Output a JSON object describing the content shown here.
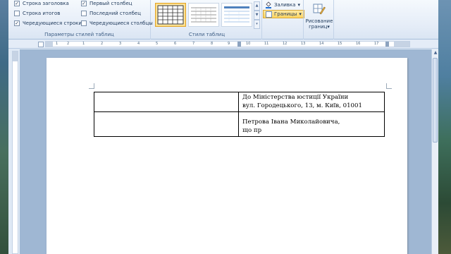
{
  "ribbon": {
    "options_group": {
      "caption": "Параметры стилей таблиц",
      "checkboxes": [
        {
          "label": "Строка заголовка",
          "checked": true
        },
        {
          "label": "Строка итогов",
          "checked": false
        },
        {
          "label": "Чередующиеся строки",
          "checked": true
        },
        {
          "label": "Первый столбец",
          "checked": true
        },
        {
          "label": "Последний столбец",
          "checked": false
        },
        {
          "label": "Чередующиеся столбцы",
          "checked": false
        }
      ]
    },
    "styles_group": {
      "caption": "Стили таблиц",
      "scroll_up": "▲",
      "scroll_down": "▼",
      "scroll_more": "▾"
    },
    "fill_label": "Заливка",
    "borders_label": "Границы",
    "dropdown_arrow": "▾",
    "draw_borders": {
      "line1": "Рисование",
      "line2": "границ",
      "arrow": "▾"
    }
  },
  "ruler": {
    "numbers": [
      "1",
      "2",
      "1",
      "2",
      "3",
      "4",
      "5",
      "6",
      "7",
      "8",
      "9",
      "10",
      "11",
      "12",
      "13",
      "14",
      "15",
      "16",
      "17"
    ]
  },
  "document": {
    "table": {
      "row1": {
        "left": "",
        "right_line1": "До Міністерства юстиції України",
        "right_line2": "вул. Городецького, 13, м. Київ, 01001"
      },
      "row2": {
        "left": "",
        "right_line1": "Петрова Івана Миколайовича,",
        "right_line2": "що пр"
      }
    }
  },
  "icons": {
    "checkmark": "✓",
    "fill": "paint-bucket-icon",
    "borders": "borders-icon",
    "draw": "pencil-table-icon"
  },
  "colors": {
    "ribbon_bg": "#e4ecf7",
    "selected_style": "#ffe9a8",
    "active_button": "#ffd560",
    "document_bg": "#9fb7d3",
    "page": "#ffffff"
  }
}
